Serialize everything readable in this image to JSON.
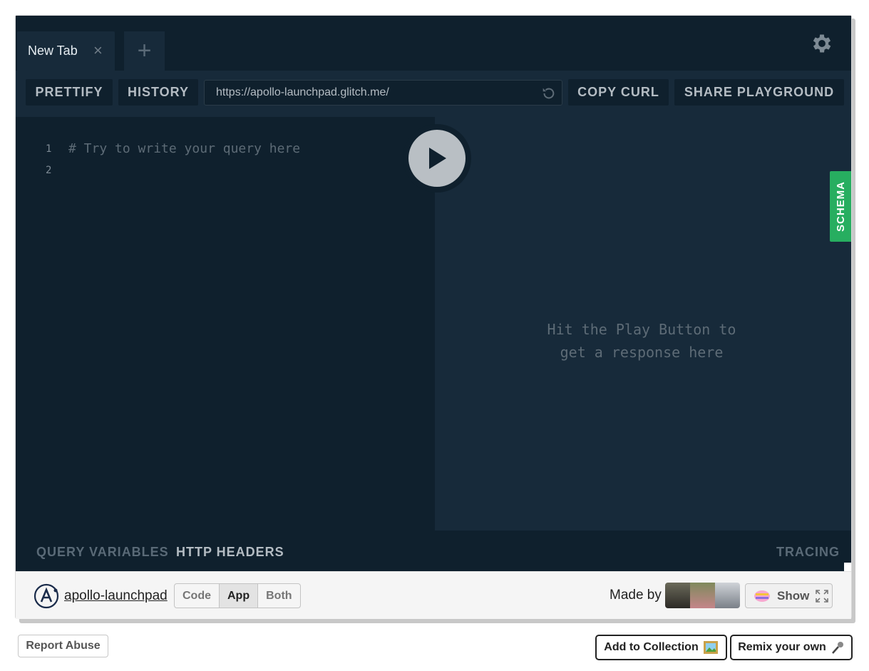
{
  "tabs": [
    {
      "label": "New Tab",
      "close_icon": "close-icon"
    }
  ],
  "new_tab_icon": "plus-icon",
  "settings_icon": "gear-icon",
  "toolbar": {
    "prettify": "PRETTIFY",
    "history": "HISTORY",
    "endpoint_url": "https://apollo-launchpad.glitch.me/",
    "copy_curl": "COPY CURL",
    "share": "SHARE PLAYGROUND"
  },
  "editor": {
    "line_numbers": [
      "1",
      "2"
    ],
    "code": "# Try to write your query here"
  },
  "result": {
    "hint": "Hit the Play Button to\nget a response here"
  },
  "schema_tab": "SCHEMA",
  "drawer": {
    "query_variables": "QUERY VARIABLES",
    "http_headers": "HTTP HEADERS",
    "tracing": "TRACING"
  },
  "footer": {
    "project_name": "apollo-launchpad",
    "view_modes": [
      "Code",
      "App",
      "Both"
    ],
    "active_mode": "App",
    "made_by": "Made by",
    "show_label": "Show"
  },
  "page": {
    "report_abuse": "Report Abuse",
    "add_to_collection": "Add to Collection",
    "remix": "Remix your own"
  },
  "colors": {
    "bg_dark": "#0f202d",
    "bg_panel": "#172a3a",
    "schema_green": "#27ae60"
  }
}
